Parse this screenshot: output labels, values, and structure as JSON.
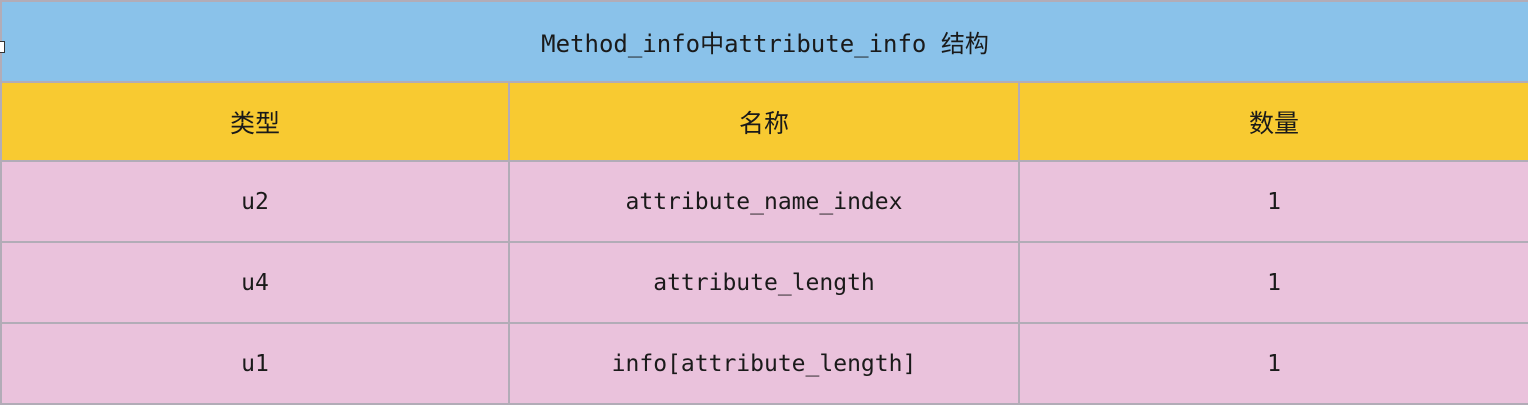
{
  "table": {
    "title": "Method_info中attribute_info 结构",
    "headers": [
      "类型",
      "名称",
      "数量"
    ],
    "rows": [
      [
        "u2",
        "attribute_name_index",
        "1"
      ],
      [
        "u4",
        "attribute_length",
        "1"
      ],
      [
        "u1",
        "info[attribute_length]",
        "1"
      ]
    ]
  },
  "colors": {
    "title_bg": "#8ac2ea",
    "header_bg": "#f8ca31",
    "body_bg": "#eac2dc",
    "border": "#b2acb7"
  }
}
